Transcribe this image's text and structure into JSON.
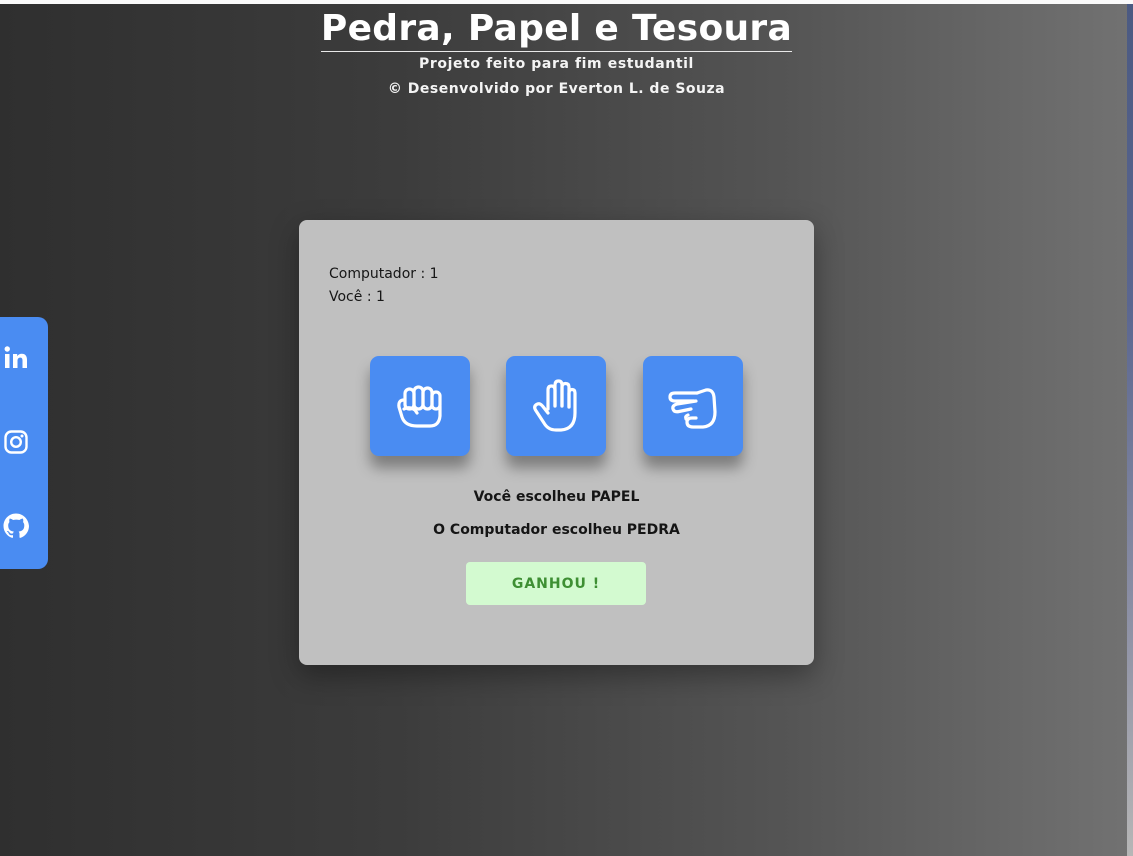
{
  "header": {
    "title": "Pedra, Papel e Tesoura",
    "subtitle": "Projeto feito para fim estudantil",
    "credit": "© Desenvolvido por Everton L. de Souza"
  },
  "social": {
    "links": [
      {
        "name": "LinkedIn",
        "icon": "linkedin-icon"
      },
      {
        "name": "Instagram",
        "icon": "instagram-icon"
      },
      {
        "name": "GitHub",
        "icon": "github-icon"
      }
    ]
  },
  "game": {
    "score_computer": "Computador : 1",
    "score_player": "Você : 1",
    "choices": [
      {
        "name": "rock",
        "icon": "rock-hand-icon"
      },
      {
        "name": "paper",
        "icon": "paper-hand-icon"
      },
      {
        "name": "scissors",
        "icon": "scissors-hand-icon"
      }
    ],
    "player_choice_text": "Você escolheu PAPEL",
    "computer_choice_text": "O Computador escolheu PEDRA",
    "result_text": "GANHOU !"
  },
  "colors": {
    "accent": "#4a8cf2",
    "panel": "#c0c0c0",
    "result_bg": "#d3fad0",
    "result_text": "#3e8f33"
  }
}
